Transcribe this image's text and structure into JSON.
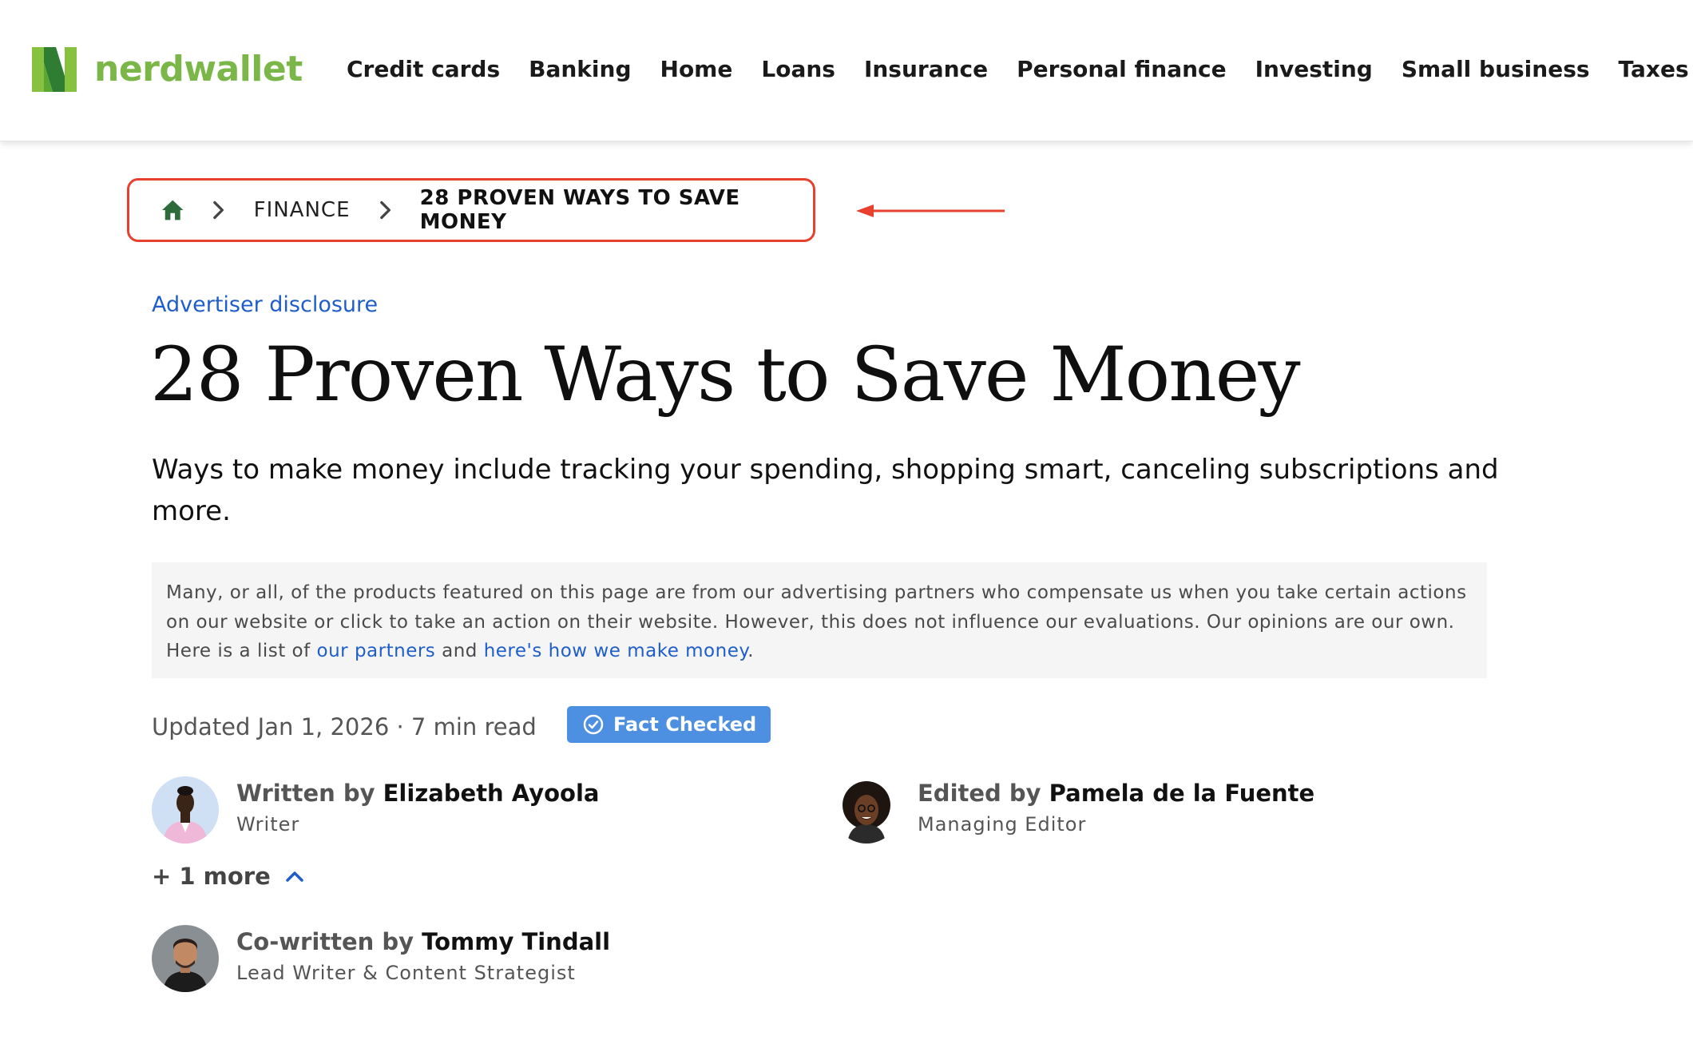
{
  "brand": {
    "name": "nerdwallet",
    "colors": {
      "logo_green": "#7ab648",
      "logo_dark": "#2e7d32",
      "link_blue": "#1f5ec9",
      "badge_blue": "#4d8fe0",
      "annotation_red": "#e8402f"
    }
  },
  "nav": {
    "items": [
      {
        "label": "Credit cards"
      },
      {
        "label": "Banking"
      },
      {
        "label": "Home"
      },
      {
        "label": "Loans"
      },
      {
        "label": "Insurance"
      },
      {
        "label": "Personal finance"
      },
      {
        "label": "Investing"
      },
      {
        "label": "Small business"
      },
      {
        "label": "Taxes"
      }
    ]
  },
  "breadcrumb": {
    "home_icon": "home-icon",
    "separator_icon": "chevron-right-icon",
    "section": "FINANCE",
    "current": "28 PROVEN WAYS TO SAVE MONEY"
  },
  "article": {
    "disclosure_link": "Advertiser disclosure",
    "title": "28 Proven Ways to Save Money",
    "subtitle": "Ways to make money include tracking your spending, shopping smart, canceling subscriptions and more.",
    "disclaimer": {
      "text": "Many, or all, of the products featured on this page are from our advertising partners who compensate us when you take certain actions on our website or click to take an action on their website. However, this does not influence our evaluations. Our opinions are our own. Here is a list of ",
      "partners_link": "our partners",
      "and_text": " and ",
      "money_link": "here's how we make money",
      "end": "."
    },
    "meta": "Updated Jan 1, 2026 · 7 min read",
    "fact_badge": "Fact Checked",
    "fact_icon": "check-circle-icon"
  },
  "authors": {
    "writer": {
      "by": "Written by ",
      "name": "Elizabeth Ayoola",
      "role": "Writer"
    },
    "editor": {
      "by": "Edited by ",
      "name": "Pamela de la Fuente",
      "role": "Managing Editor"
    },
    "more_toggle": "+ 1 more",
    "cowriter": {
      "by": "Co-written by ",
      "name": "Tommy Tindall",
      "role": "Lead Writer & Content Strategist"
    }
  }
}
